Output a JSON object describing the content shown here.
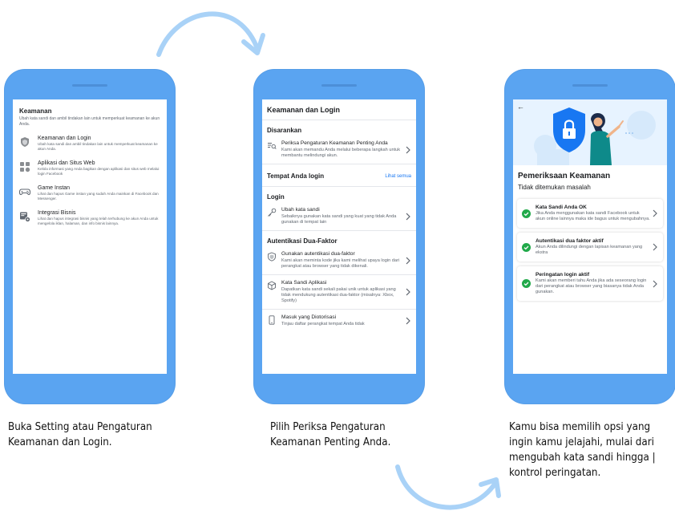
{
  "colors": {
    "phone_body": "#5aa4f1",
    "arrow": "#a9d2f7",
    "link": "#1877f2",
    "check": "#21a94a",
    "hero_bg": "#e7f3ff"
  },
  "phone1": {
    "title": "Keamanan",
    "subtitle": "Ubah kata sandi dan ambil tindakan lain untuk memperkuat keamanan ke akun Anda.",
    "items": [
      {
        "icon": "shield-icon",
        "title": "Keamanan dan Login",
        "desc": "Ubah kata sandi dan ambil tindakan lain untuk memperkuat keamanan ke akun Anda."
      },
      {
        "icon": "apps-icon",
        "title": "Aplikasi dan Situs Web",
        "desc": "Kelola informasi yang Anda bagikan dengan aplikasi dan situs web melalui login Facebook"
      },
      {
        "icon": "gamepad-icon",
        "title": "Game Instan",
        "desc": "Lihat dan hapus Game instan yang sudah Anda mainkan di Facebook dan Messenger."
      },
      {
        "icon": "business-integration-icon",
        "title": "Integrasi Bisnis",
        "desc": "Lihat dan hapus integrasi bisnis yang telah terhubung ke akun Anda untuk mengelola iklan, halaman, dan info bisnis lainnya."
      }
    ]
  },
  "phone2": {
    "title": "Keamanan dan Login",
    "section_recommended": "Disarankan",
    "recommended": {
      "icon": "checklist-icon",
      "title": "Periksa Pengaturan Keamanan Penting Anda",
      "desc": "Kami akan memandu Anda melalui beberapa langkah untuk membantu melindungi akun."
    },
    "section_where": "Tempat Anda login",
    "see_all": "Lihat semua",
    "section_login": "Login",
    "login_row": {
      "icon": "key-icon",
      "title": "Ubah kata sandi",
      "desc": "Sebaiknya gunakan kata sandi yang kuat yang tidak Anda gunakan di tempat lain"
    },
    "section_2fa": "Autentikasi Dua-Faktor",
    "twofa_rows": [
      {
        "icon": "shield-small-icon",
        "title": "Gunakan autentikasi dua-faktor",
        "desc": "Kami akan meminta kode jika kami melihat upaya login dari perangkat atau browser yang tidak dikenali."
      },
      {
        "icon": "cube-icon",
        "title": "Kata Sandi Aplikasi",
        "desc": "Dapatkan kata sandi sekali pakai unik untuk aplikasi yang tidak mendukung autentikasi dua-faktor (misalnya: Xbox, Spotify)"
      },
      {
        "icon": "phone-icon",
        "title": "Masuk yang Diotorisasi",
        "desc": "Tinjau daftar perangkat tempat Anda tidak"
      }
    ]
  },
  "phone3": {
    "back": "←",
    "title": "Pemeriksaan Keamanan",
    "subtitle": "Tidak ditemukan masalah",
    "cards": [
      {
        "title": "Kata Sandi Anda OK",
        "desc": "Jika Anda menggunakan kata sandi Facebook untuk akun online lainnya maka ide bagus untuk mengubahnya."
      },
      {
        "title": "Autentikasi dua faktor aktif",
        "desc": "Akun Anda dilindungi dengan lapisan keamanan yang ekstra"
      },
      {
        "title": "Peringatan login aktif",
        "desc": "Kami akan memberi tahu Anda jika ada seseorang login dari perangkat atau browser yang biasanya tidak Anda gunakan."
      }
    ]
  },
  "captions": {
    "step1": [
      "Buka Setting atau Pengaturan",
      "Keamanan dan Login."
    ],
    "step2": [
      "Pilih Periksa Pengaturan",
      "Keamanan Penting Anda."
    ],
    "step3": [
      "Kamu bisa memilih opsi yang",
      "ingin kamu jelajahi, mulai dari",
      "mengubah kata sandi hingga |",
      "kontrol peringatan."
    ]
  }
}
